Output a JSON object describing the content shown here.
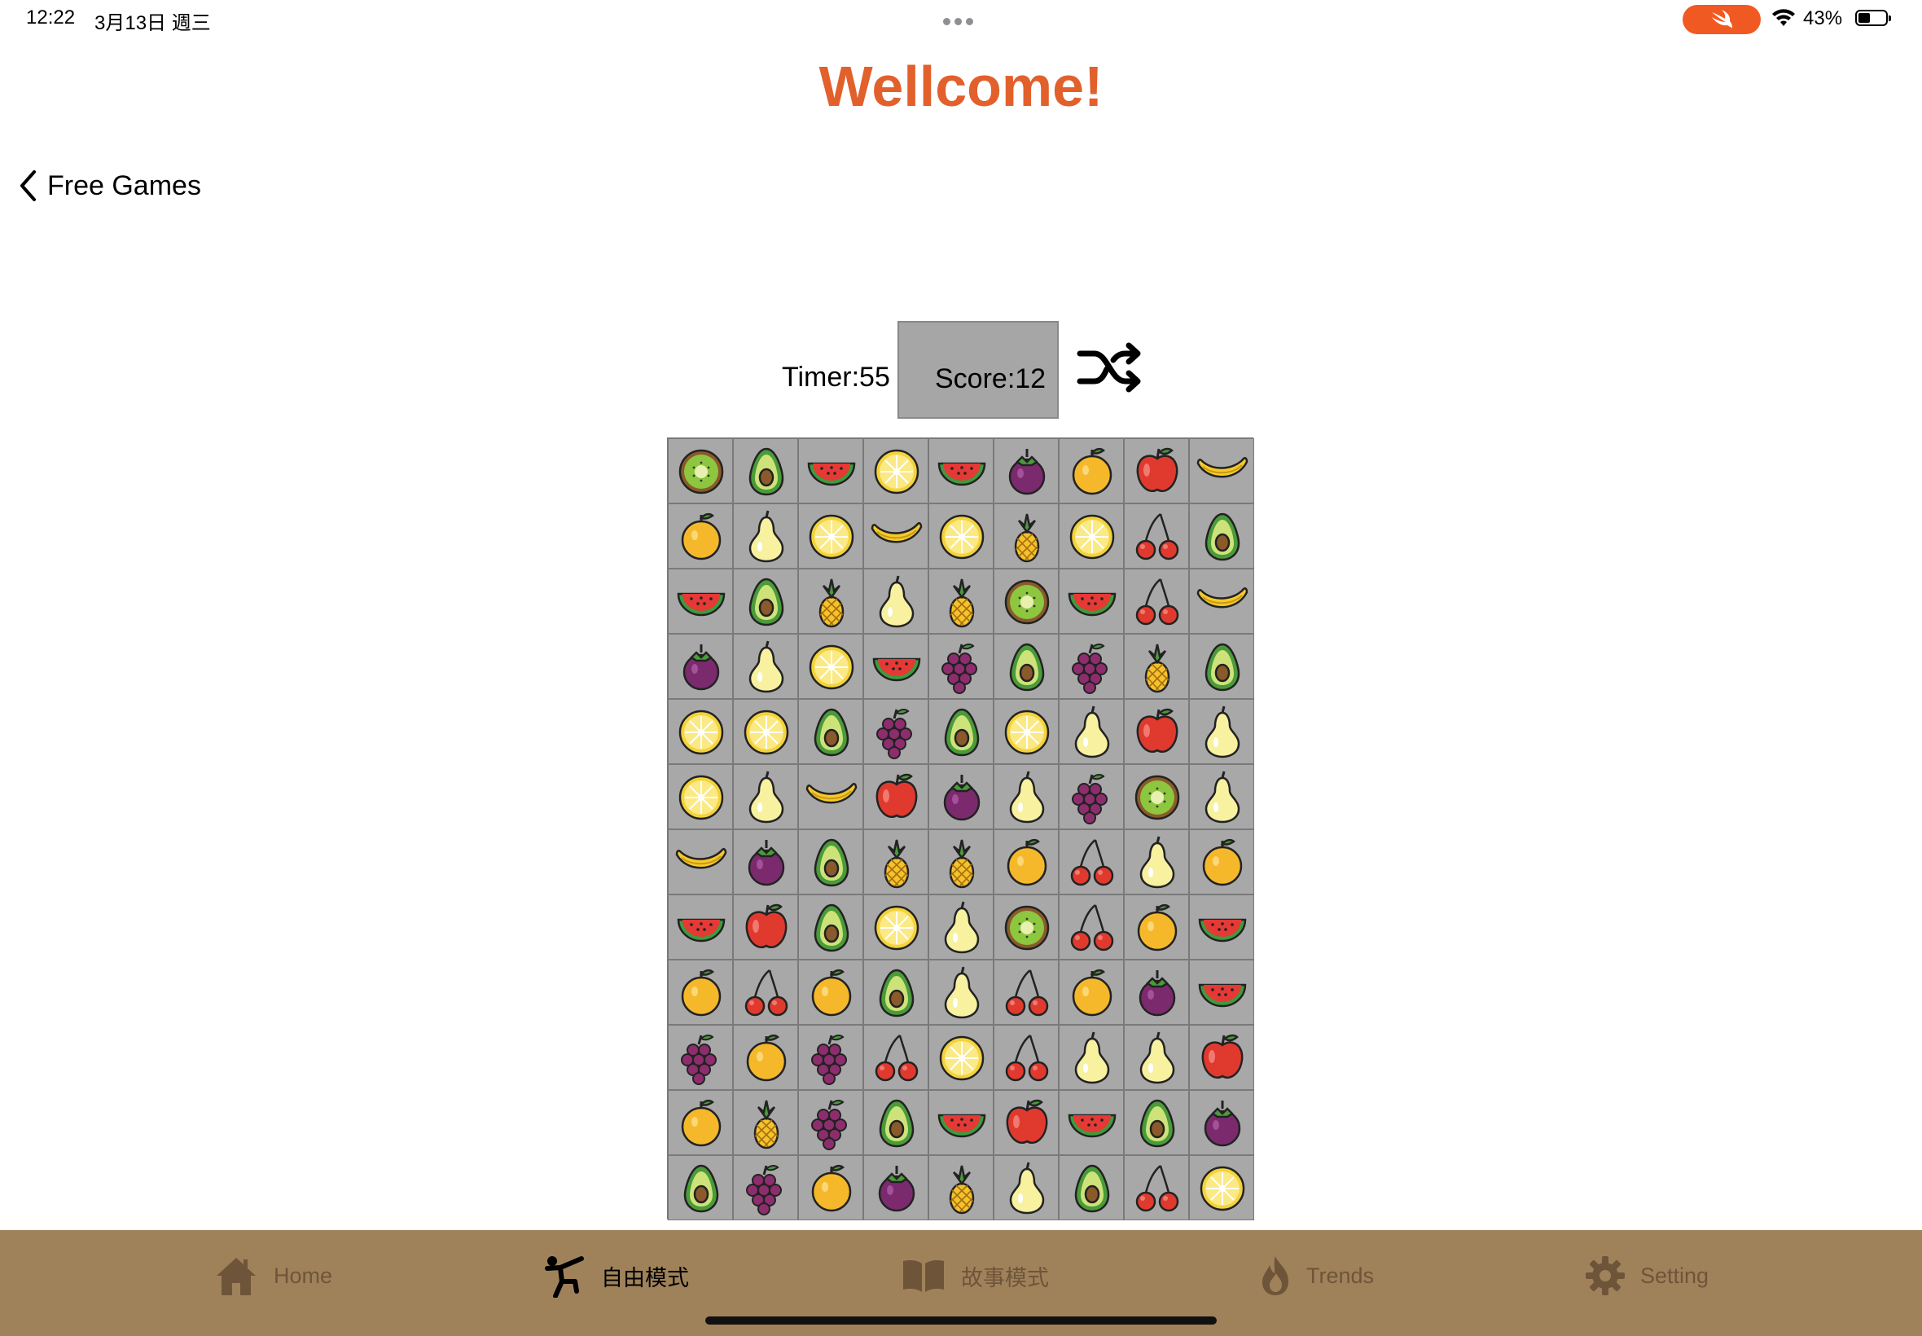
{
  "status_bar": {
    "time": "12:22",
    "date": "3月13日 週三",
    "battery": "43%"
  },
  "header": {
    "title": "Wellcome!",
    "title_color": "#e2602b"
  },
  "nav": {
    "back_label": "Free Games"
  },
  "hud": {
    "timer": "Timer:55",
    "score": "Score:12",
    "shuffle_icon": "shuffle-icon"
  },
  "board": {
    "columns": 9,
    "rows": 12,
    "grid": [
      [
        "kiwi",
        "avocado",
        "watermelon",
        "lemon",
        "watermelon",
        "mangosteen",
        "orange",
        "apple",
        "banana"
      ],
      [
        "orange",
        "pear",
        "lemon",
        "banana",
        "lemon",
        "pineapple",
        "lemon",
        "cherry",
        "avocado"
      ],
      [
        "watermelon",
        "avocado",
        "pineapple",
        "pear",
        "pineapple",
        "kiwi",
        "watermelon",
        "cherry",
        "banana"
      ],
      [
        "mangosteen",
        "pear",
        "lemon",
        "watermelon",
        "grape",
        "avocado",
        "grape",
        "pineapple",
        "avocado"
      ],
      [
        "lemon",
        "lemon",
        "avocado",
        "grape",
        "avocado",
        "lemon",
        "pear",
        "apple",
        "pear"
      ],
      [
        "lemon",
        "pear",
        "banana",
        "apple",
        "mangosteen",
        "pear",
        "grape",
        "kiwi",
        "pear"
      ],
      [
        "banana",
        "mangosteen",
        "avocado",
        "pineapple",
        "pineapple",
        "orange",
        "cherry",
        "pear",
        "orange"
      ],
      [
        "watermelon",
        "apple",
        "avocado",
        "lemon",
        "pear",
        "kiwi",
        "cherry",
        "orange",
        "watermelon"
      ],
      [
        "orange",
        "cherry",
        "orange",
        "avocado",
        "pear",
        "cherry",
        "orange",
        "mangosteen",
        "watermelon"
      ],
      [
        "grape",
        "orange",
        "grape",
        "cherry",
        "lemon",
        "cherry",
        "pear",
        "pear",
        "apple"
      ],
      [
        "orange",
        "pineapple",
        "grape",
        "avocado",
        "watermelon",
        "apple",
        "watermelon",
        "avocado",
        "mangosteen"
      ],
      [
        "avocado",
        "grape",
        "orange",
        "mangosteen",
        "pineapple",
        "pear",
        "avocado",
        "cherry",
        "lemon"
      ]
    ]
  },
  "tabbar": {
    "background": "#a0825a",
    "items": [
      {
        "label": "Home",
        "icon": "house-icon",
        "active": false
      },
      {
        "label": "自由模式",
        "icon": "martial-arts-figure-icon",
        "active": true
      },
      {
        "label": "故事模式",
        "icon": "book-icon",
        "active": false
      },
      {
        "label": "Trends",
        "icon": "flame-icon",
        "active": false
      },
      {
        "label": "Setting",
        "icon": "gear-icon",
        "active": false
      }
    ]
  }
}
